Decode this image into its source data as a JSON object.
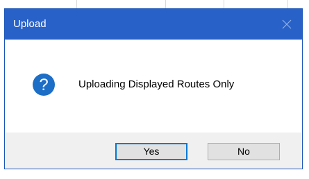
{
  "dialog": {
    "title": "Upload",
    "close_icon": "close-icon",
    "message_icon": "question-icon",
    "message": "Uploading Displayed Routes Only",
    "buttons": {
      "yes_label": "Yes",
      "no_label": "No"
    }
  },
  "colors": {
    "titlebar": "#2861c8",
    "title_text": "#ffffff",
    "close_glyph": "#8fb1ea",
    "dialog_border": "#1a55b8",
    "footer": "#f0f0f0",
    "icon_fill": "#1c6ec6",
    "default_button_border": "#0078d7"
  }
}
